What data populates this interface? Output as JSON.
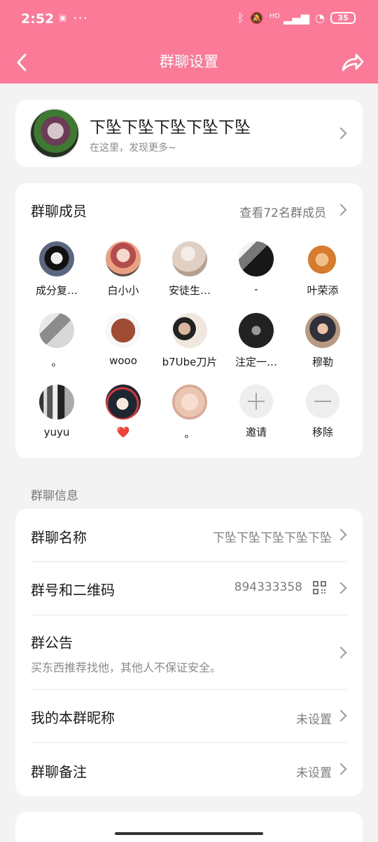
{
  "status": {
    "time": "2:52",
    "mini_icon": "▣",
    "dots": "···",
    "bluetooth": "ᛒ",
    "mute": "🔕",
    "signal": "ᴴᴰ ▂▄▆",
    "wifi": "◔",
    "battery": "35"
  },
  "nav": {
    "title": "群聊设置",
    "back_icon": "chevron-left-icon",
    "share_icon": "share-icon",
    "accent": "#fb7a97"
  },
  "profile": {
    "name": "下坠下坠下坠下坠下坠",
    "subtitle": "在这里，发现更多~"
  },
  "members": {
    "title": "群聊成员",
    "link": "查看72名群成员",
    "items": [
      {
        "name": "成分复…"
      },
      {
        "name": "白小小"
      },
      {
        "name": "安徒生…"
      },
      {
        "name": "-"
      },
      {
        "name": "叶荣添"
      },
      {
        "name": "。"
      },
      {
        "name": "wooo"
      },
      {
        "name": "b7Ube刀片"
      },
      {
        "name": "注定一…"
      },
      {
        "name": "穆勒"
      },
      {
        "name": "yuyu"
      },
      {
        "name": "❤️"
      },
      {
        "name": "。"
      }
    ],
    "invite": "邀请",
    "remove": "移除"
  },
  "group_info": {
    "section_label": "群聊信息",
    "name_label": "群聊名称",
    "name_value": "下坠下坠下坠下坠下坠",
    "id_label": "群号和二维码",
    "id_value": "894333358",
    "notice_label": "群公告",
    "notice_text": "买东西推荐找他，其他人不保证安全。",
    "nickname_label": "我的本群昵称",
    "nickname_value": "未设置",
    "remark_label": "群聊备注",
    "remark_value": "未设置"
  }
}
